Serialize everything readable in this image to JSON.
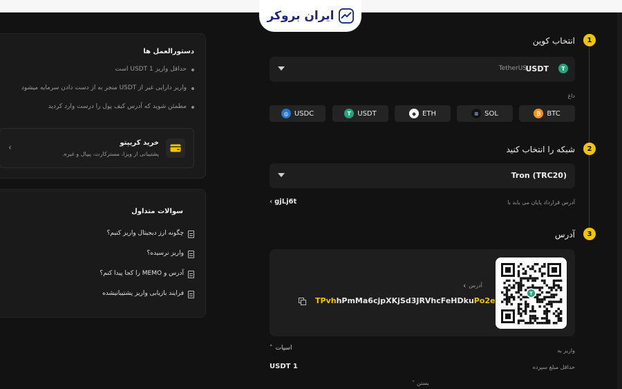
{
  "brand": {
    "name": "ایران بروکر"
  },
  "guide": {
    "title": "دستورالعمل ها",
    "items": [
      "حداقل واریز USDT 1 است",
      "واریز دارایی غیر از USDT منجر به از دست دادن سرمایه میشود",
      "مطمئن شوید که آدرس کیف پول را درست وارد کردید"
    ],
    "buy": {
      "title": "خرید کریپتو",
      "subtitle": "پشتیبانی از ویزا، مسترکارت، پیپال و غیره.",
      "icon": "wallet-card-icon"
    }
  },
  "faq": {
    "title": "سوالات متداول",
    "items": [
      "چگونه ارز دیجیتال واریز کنیم؟",
      "واریز نرسیده؟",
      "آدرس و MEMO را کجا پیدا کنم؟",
      "فرایند بازیابی واریز پشتیبانیشده"
    ]
  },
  "steps": {
    "coin": {
      "number": "1",
      "label": "انتخاب کوین",
      "selected_symbol": "USDT",
      "selected_name": "TetherUS",
      "hot_label": "داغ"
    },
    "network": {
      "number": "2",
      "label": "شبکه را انتخاب کنید",
      "selected": "Tron (TRC20)",
      "contract_label": "آدرس قرارداد پایان می یابد با",
      "contract_value": "gjLj6t"
    },
    "address": {
      "number": "3",
      "label": "آدرس",
      "field_label": "آدرس",
      "addr_prefix": "TPvh",
      "addr_middle": "hPmMa6cjpXKjSd3JRVhcFeHDku",
      "addr_suffix": "Po2e"
    }
  },
  "hot_coins": [
    {
      "symbol": "USDC",
      "color": "#2775ca",
      "icon": "usdc-icon",
      "glyph": "◎"
    },
    {
      "symbol": "USDT",
      "color": "#26a17b",
      "icon": "usdt-icon",
      "glyph": "T"
    },
    {
      "symbol": "ETH",
      "color": "#ffffff",
      "icon": "eth-icon",
      "glyph": "◆"
    },
    {
      "symbol": "SOL",
      "color": "#111111",
      "icon": "sol-icon",
      "glyph": "≡"
    },
    {
      "symbol": "BTC",
      "color": "#f7931a",
      "icon": "btc-icon",
      "glyph": "₿"
    }
  ],
  "details": {
    "toggle_label": "اسپات",
    "deposit_to_label": "واریز به",
    "min_label": "حداقل مبلغ سپرده",
    "min_value": "USDT 1",
    "close_label": "بستن"
  },
  "colors": {
    "accent": "#f0c400",
    "background": "#121212",
    "panel": "#1e1e1e",
    "brand": "#1b2a7a"
  }
}
